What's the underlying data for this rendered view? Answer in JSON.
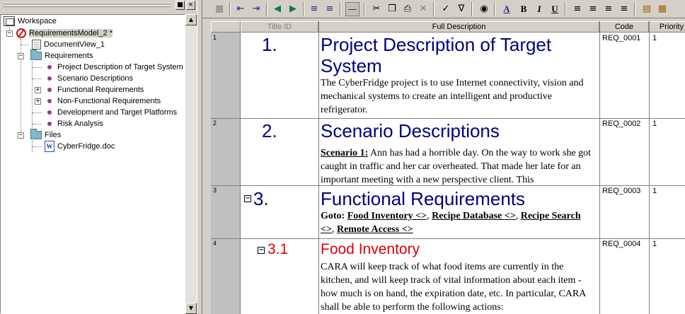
{
  "workspace": {
    "title": "Workspace",
    "model": "RequirementsModel_2 *",
    "document_view": "DocumentView_1",
    "requirements_folder": "Requirements",
    "requirements": [
      "Project Description of Target System",
      "Scenario Descriptions",
      "Functional Requirements",
      "Non-Functional Requirements",
      "Development and Target Platforms",
      "Risk Analysis"
    ],
    "files_folder": "Files",
    "file": "CyberFridge.doc"
  },
  "left_header": {
    "pin_button": "-□",
    "close_button": "×"
  },
  "grid": {
    "columns": {
      "title_id": "Title ID",
      "full_description": "Full Description",
      "code": "Code",
      "priority": "Priority"
    },
    "rows": [
      {
        "row": "1",
        "num": "1.",
        "title": "Project Description of Target System",
        "body": "The CyberFridge project is to use Internet connectivity, vision and mechanical systems to create an intelligent and productive refrigerator.",
        "code": "REQ_0001",
        "priority": "1"
      },
      {
        "row": "2",
        "num": "2.",
        "title": "Scenario Descriptions",
        "body_label": "Scenario 1:",
        "body": " Ann has had a horrible day.  On the way to work she got caught in traffic and her car overheated.  That made her late for an important meeting with a new perspective client.  This",
        "code": "REQ_0002",
        "priority": "1"
      },
      {
        "row": "3",
        "num": "3.",
        "title": "Functional Requirements",
        "goto_label": "Goto:",
        "links": [
          "Food Inventory <>",
          "Recipe Database <>",
          "Recipe Search <>",
          "Remote Access <>"
        ],
        "code": "REQ_0003",
        "priority": "1"
      },
      {
        "row": "4",
        "num": "3.1",
        "title": "Food Inventory",
        "body": "CARA will keep track of what food items are currently in the kitchen, and will keep track of vital information about each item - how much is on hand, the expiration date, etc.  In particular, CARA shall be able to perform the following actions:",
        "code": "REQ_0004",
        "priority": "1"
      }
    ]
  },
  "colors": {
    "heading": "#000080",
    "subheading": "#e00000",
    "row_header": "#c0c0c0"
  }
}
